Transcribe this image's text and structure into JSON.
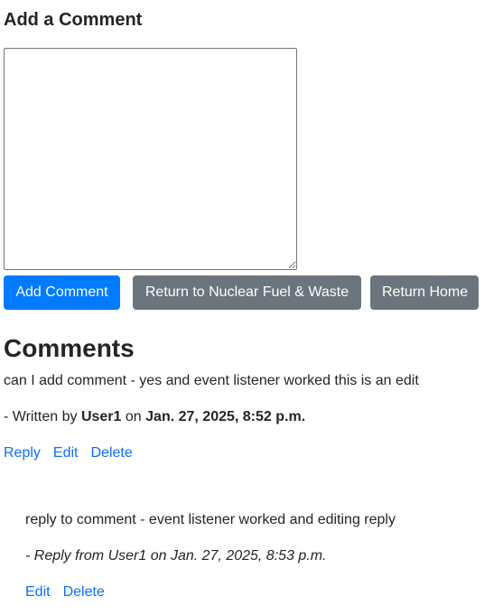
{
  "form": {
    "title": "Add a Comment",
    "textarea_value": "",
    "buttons": {
      "add_comment": "Add Comment",
      "return_section": "Return to Nuclear Fuel & Waste",
      "return_home": "Return Home"
    }
  },
  "comments": {
    "title": "Comments",
    "items": [
      {
        "text": "can I add comment - yes and event listener worked this is an edit",
        "meta_prefix": "- Written by",
        "author": "User1",
        "meta_on": "on",
        "timestamp": "Jan. 27, 2025, 8:52 p.m.",
        "actions": {
          "reply": "Reply",
          "edit": "Edit",
          "delete": "Delete"
        },
        "replies": [
          {
            "text": "reply to comment - event listener worked and editing reply",
            "meta": "- Reply from User1 on Jan. 27, 2025, 8:53 p.m.",
            "actions": {
              "edit": "Edit",
              "delete": "Delete"
            }
          }
        ]
      }
    ]
  },
  "colors": {
    "primary": "#007bff",
    "secondary": "#6c757d",
    "link": "#0d6efd",
    "text": "#212529"
  }
}
